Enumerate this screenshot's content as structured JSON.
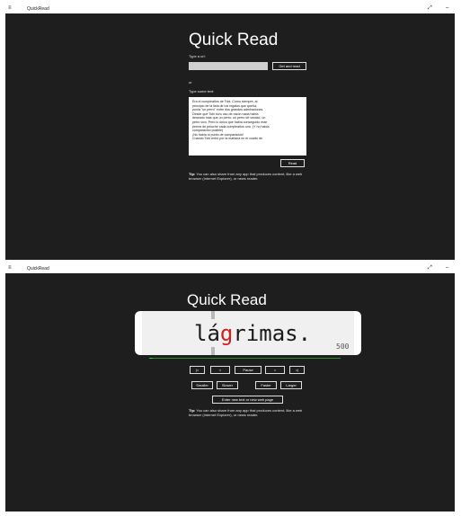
{
  "top_window": {
    "titlebar": {
      "menu_icon": "hamburger-icon",
      "title": "QuickRead",
      "expand_icon": "expand-icon",
      "minimize_icon": "minimize-icon"
    },
    "heading": "Quick Read",
    "url_label": "Type a url:",
    "url_value": "",
    "get_and_read_label": "Get and read",
    "or_label": "or",
    "text_label": "Type some text:",
    "text_lines": [
      "Era el cumpleaños de Tobi. Como siempre, al",
      "principio de la lista de los regalos que quería,",
      "ponía \"un perro\" entre dos grandes admiraciones.",
      "Desde que Tobi tuvo uso de razón nada había",
      "deseado más que un perro: un perro de verdad, un",
      "perro vivo. Pero lo único que había conseguido eran",
      "perros de peluche cada cumpleaños uno. (Y no había",
      "comparación posible)",
      "¡No había ni punto de comparación!",
      "Cuando Tobi entró por la mañana en el cuarto de"
    ],
    "read_label": "Read",
    "tip_bold": "Tip:",
    "tip_text": "You can also share from any app that produces content, like a web browser (Internet Explorer), or news reader."
  },
  "bottom_window": {
    "titlebar": {
      "menu_icon": "hamburger-icon",
      "title": "QuickRead",
      "expand_icon": "expand-icon",
      "minimize_icon": "minimize-icon"
    },
    "heading": "Quick Read",
    "word_before": "lá",
    "word_pivot": "g",
    "word_after": "rimas.",
    "wpm": "500",
    "progress_fraction": 0.02,
    "controls": {
      "first": "|<",
      "prev": "<",
      "pause": "Pause",
      "next": ">",
      "last": ">|"
    },
    "size_speed": {
      "smaller": "Smaller",
      "slower": "Slower",
      "faster": "Faster",
      "larger": "Larger"
    },
    "new_text_label": "Enter new text or new web page",
    "tip_bold": "Tip:",
    "tip_text": "You can also share from any app that produces content, like a web browser (Internet Explorer), or news reader."
  }
}
